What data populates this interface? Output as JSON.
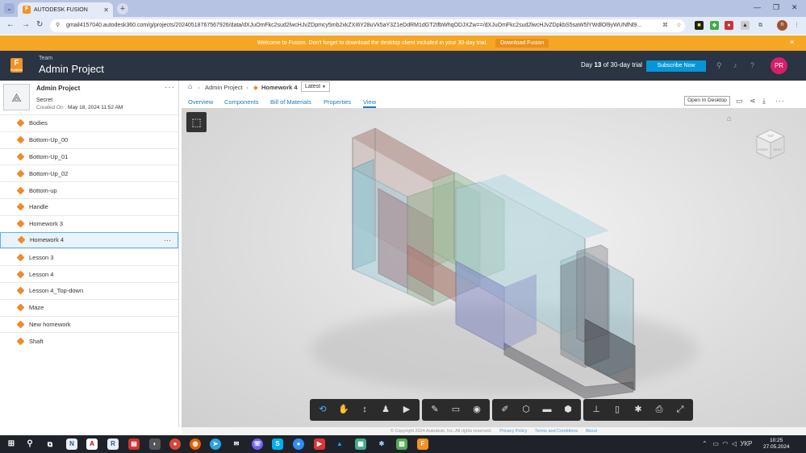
{
  "browser": {
    "tab_title": "AUTODESK FUSION",
    "tab_favicon": "F",
    "url": "gmail4157040.autodesk360.com/g/projects/20240518767567926/data/dXJuOmFkc2sud2lwcHJvZDpmcy5mb2xkZXI6Y28uVk5aY3Z1eDdRM1dGT2tfbWhqODJXZw==/dXJuOmFkc2sud2lwcHJvZDpkbS5saW5lYWdlOl9yWUNfNl9...",
    "profile_initial": "n"
  },
  "banner": {
    "message": "Welcome to Fusion. Don't forget to download the desktop client included in your 30-day trial.",
    "button": "Download Fusion",
    "close": "✕"
  },
  "header": {
    "team_label": "Team",
    "project_title": "Admin Project",
    "trial_prefix": "Day",
    "trial_day": "13",
    "trial_suffix": "of 30-day trial",
    "subscribe_label": "Subscribe Now",
    "avatar_initials": "PR",
    "logo_letter": "F",
    "logo_sub": "FUSION"
  },
  "project": {
    "name": "Admin Project",
    "visibility": "Secret",
    "created_label": "Created On :",
    "created_value": "May 18, 2024 11:52 AM",
    "more": "···"
  },
  "files": [
    {
      "name": "Bodies"
    },
    {
      "name": "Bottom-Up_00"
    },
    {
      "name": "Bottom-Up_01"
    },
    {
      "name": "Bottom-Up_02"
    },
    {
      "name": "Bottom-up"
    },
    {
      "name": "Handle"
    },
    {
      "name": "Homework 3"
    },
    {
      "name": "Homework 4"
    },
    {
      "name": "Lesson 3"
    },
    {
      "name": "Lesson 4"
    },
    {
      "name": "Lesson 4_Top-down"
    },
    {
      "name": "Maze"
    },
    {
      "name": "New homework"
    },
    {
      "name": "Shaft"
    }
  ],
  "selected_file": "Homework 4",
  "breadcrumb": {
    "project": "Admin Project",
    "file": "Homework 4",
    "version": "Latest"
  },
  "tabs": [
    "Overview",
    "Components",
    "Bill of Materials",
    "Properties",
    "View"
  ],
  "active_tab": "View",
  "open_desktop_label": "Open In Desktop",
  "viewcube_labels": {
    "top": "TOP",
    "front": "FRONT",
    "right": "RIGHT"
  },
  "footer": {
    "copyright": "© Copyright 2024 Autodesk, Inc. All rights reserved.",
    "privacy": "Privacy Policy",
    "terms": "Terms and Conditions",
    "about": "About"
  },
  "taskbar": {
    "lang": "УКР",
    "time": "10:25",
    "date": "27.05.2024"
  },
  "colors": {
    "banner": "#f5a623",
    "header": "#2a3442",
    "accent": "#0696d7",
    "avatar": "#d61f69",
    "fusion_orange": "#f29222"
  },
  "toolbar_icons": [
    "orbit-icon",
    "pan-icon",
    "zoom-icon",
    "first-person-icon",
    "camera-icon",
    "markup-icon",
    "section-icon",
    "explode-icon",
    "measure-icon",
    "model-browser-icon",
    "properties-icon",
    "model-structure-icon",
    "document-browser-icon",
    "settings-icon",
    "print-icon",
    "fullscreen-icon"
  ]
}
